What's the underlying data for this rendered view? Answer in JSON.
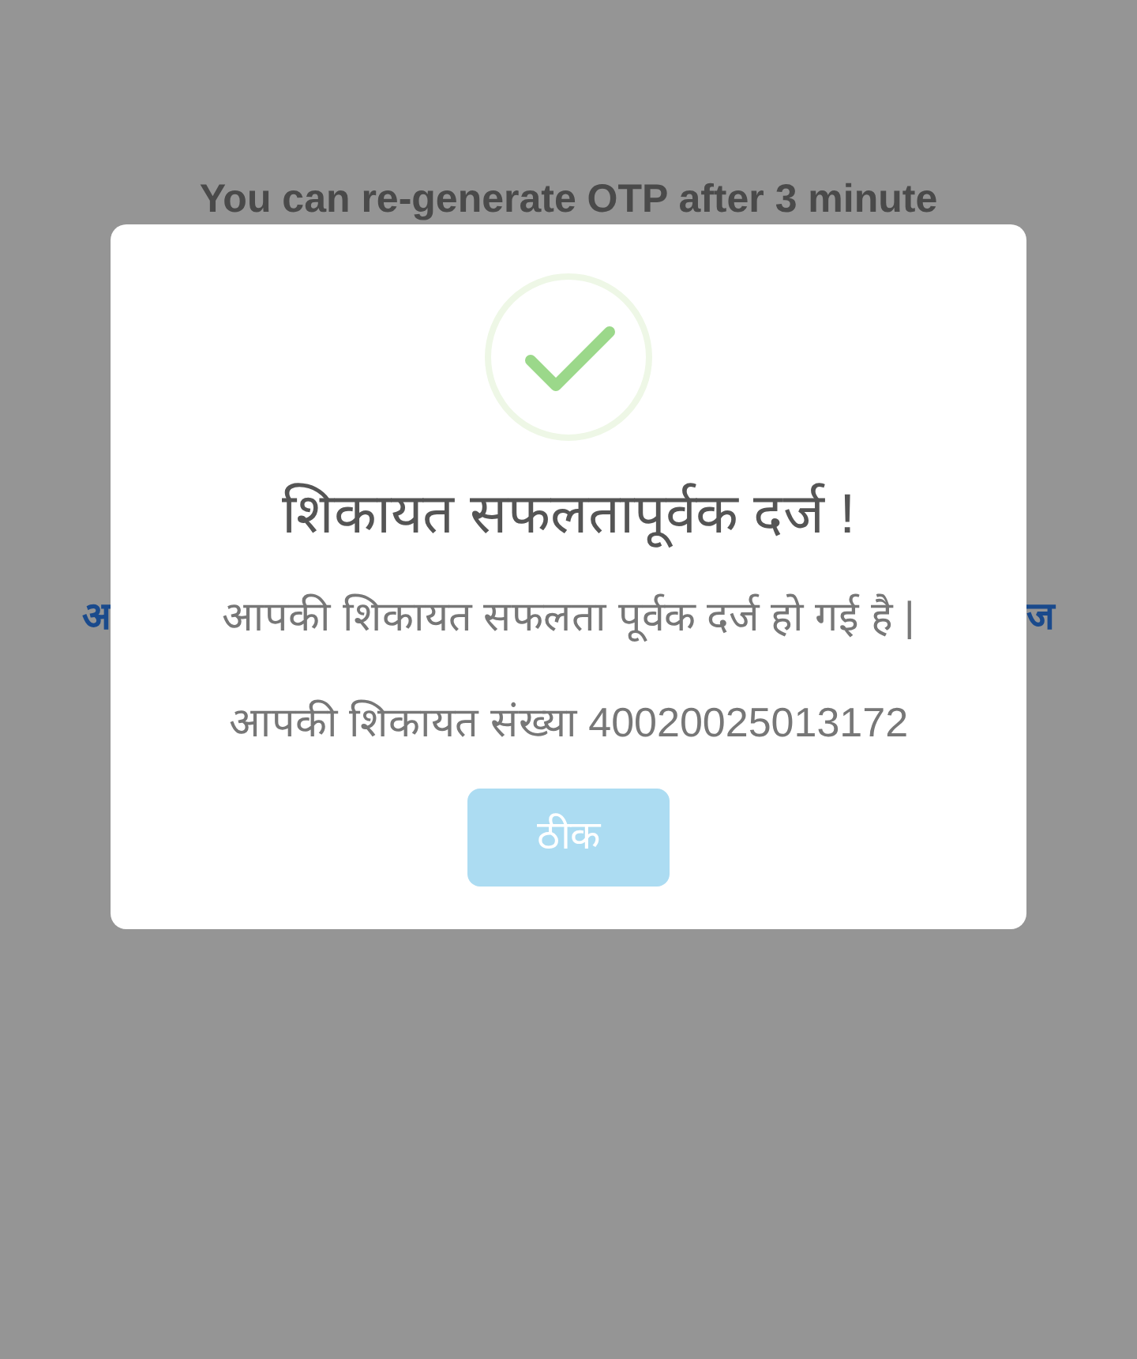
{
  "background": {
    "notice": "You can re-generate OTP after 3 minute",
    "side_texts": [
      "अ",
      "ज"
    ]
  },
  "dialog": {
    "title": "शिकायत सफलतापूर्वक दर्ज !",
    "message": "आपकी शिकायत सफलता पूर्वक दर्ज हो गई है |",
    "complaint_number": "आपकी शिकायत संख्या 40020025013172",
    "button": {
      "label": "ठीक",
      "disabled": true
    }
  }
}
